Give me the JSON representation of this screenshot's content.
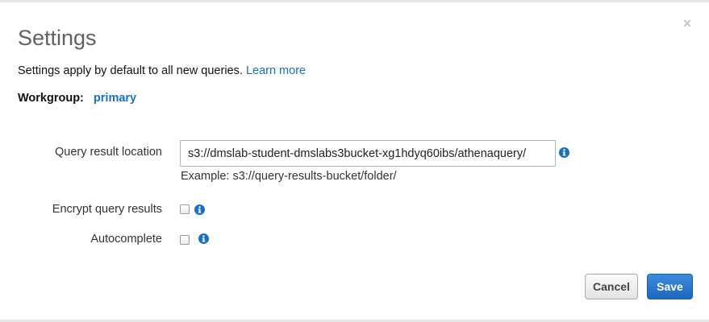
{
  "dialog": {
    "title": "Settings",
    "close_icon": "close-icon",
    "description": "Settings apply by default to all new queries.",
    "learn_more": "Learn more"
  },
  "workgroup": {
    "label": "Workgroup:",
    "value": "primary"
  },
  "query_result_location": {
    "label": "Query result location",
    "value": "s3://dmslab-student-dmslabs3bucket-xg1hdyq60ibs/athenaquery/",
    "hint": "Example: s3://query-results-bucket/folder/",
    "info_icon": "info-icon"
  },
  "encrypt_query_results": {
    "label": "Encrypt query results",
    "checked": false,
    "info_icon": "info-icon"
  },
  "autocomplete": {
    "label": "Autocomplete",
    "checked": false,
    "info_icon": "info-icon"
  },
  "buttons": {
    "cancel": "Cancel",
    "save": "Save"
  },
  "colors": {
    "link": "#1a6fc0",
    "primary_button": "#2a73c8",
    "title": "#5f6163"
  }
}
